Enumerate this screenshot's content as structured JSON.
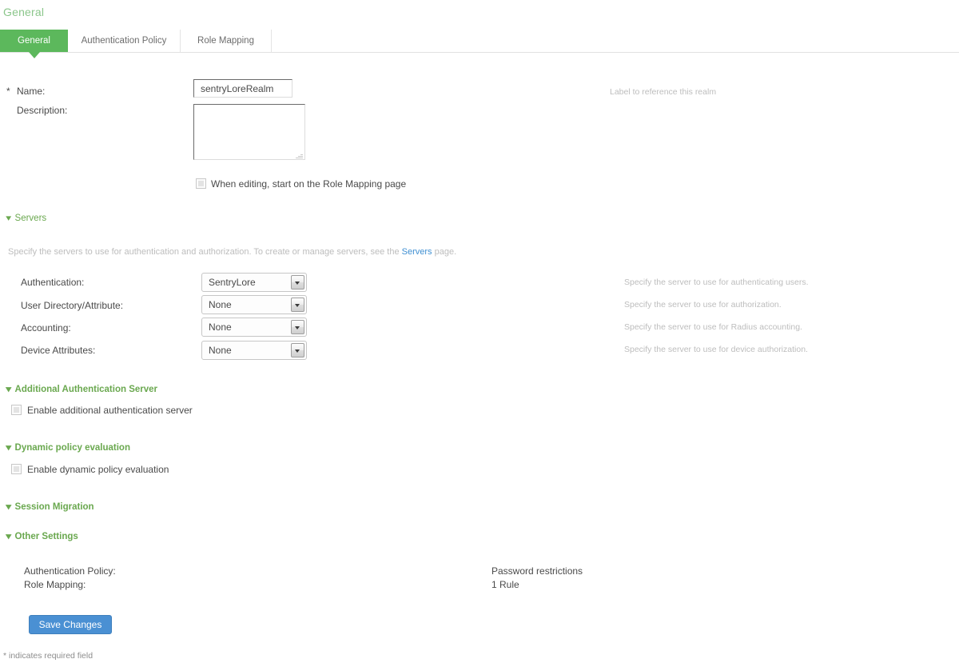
{
  "page": {
    "title": "General",
    "footnote": "* indicates required field",
    "required_marker": "*"
  },
  "tabs": [
    {
      "label": "General",
      "active": true
    },
    {
      "label": "Authentication Policy",
      "active": false
    },
    {
      "label": "Role Mapping",
      "active": false
    }
  ],
  "form": {
    "name": {
      "label": "Name:",
      "value": "sentryLoreRealm",
      "placeholder": "",
      "hint": "Label to reference this realm"
    },
    "description": {
      "label": "Description:",
      "value": "",
      "placeholder": ""
    },
    "start_on_role_mapping": {
      "label": "When editing, start on the Role Mapping page",
      "checked": false
    }
  },
  "servers": {
    "section_label": "Servers",
    "description_prefix": "Specify the servers to use for authentication and authorization. To create or manage servers, see the ",
    "link_label": "Servers",
    "description_suffix": " page.",
    "rows": [
      {
        "label": "Authentication:",
        "value": "SentryLore",
        "hint": "Specify the server to use for authenticating users."
      },
      {
        "label": "User Directory/Attribute:",
        "value": "None",
        "hint": "Specify the server to use for authorization."
      },
      {
        "label": "Accounting:",
        "value": "None",
        "hint": "Specify the server to use for Radius accounting."
      },
      {
        "label": "Device Attributes:",
        "value": "None",
        "hint": "Specify the server to use for device authorization."
      }
    ]
  },
  "additional_auth_server": {
    "section_label": "Additional Authentication Server",
    "checkbox_label": "Enable additional authentication server",
    "checked": false
  },
  "dynamic_policy": {
    "section_label": "Dynamic policy evaluation",
    "checkbox_label": "Enable dynamic policy evaluation",
    "checked": false
  },
  "session_migration": {
    "section_label": "Session Migration"
  },
  "other_settings": {
    "section_label": "Other Settings",
    "rows": [
      {
        "label": "Authentication Policy:",
        "value": "Password restrictions"
      },
      {
        "label": "Role Mapping:",
        "value": "1 Rule"
      }
    ]
  },
  "actions": {
    "save_label": "Save Changes"
  },
  "icons": {
    "chevron_down": "❯",
    "chevron_glyph": "⌄"
  },
  "colors": {
    "accent_green": "#5cb85c",
    "section_green": "#6aa84f",
    "title_green": "#8bc68b",
    "link_blue": "#3f8fd2",
    "button_blue": "#4a90d3"
  }
}
